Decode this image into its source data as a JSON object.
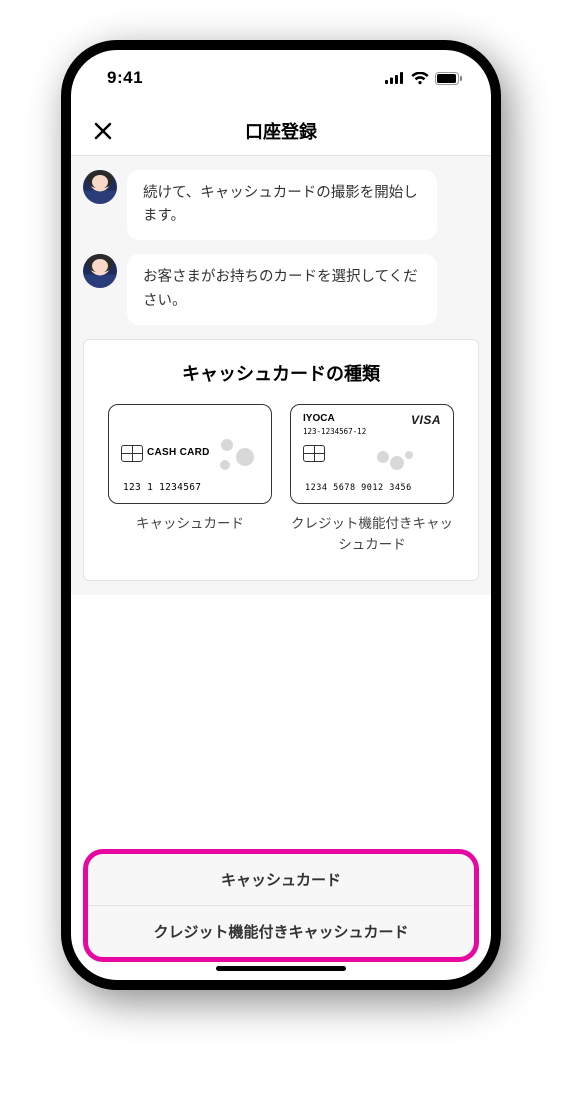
{
  "status": {
    "time": "9:41"
  },
  "header": {
    "title": "口座登録"
  },
  "messages": [
    {
      "text": "続けて、キャッシュカードの撮影を開始します。"
    },
    {
      "text": "お客さまがお持ちのカードを選択してください。"
    }
  ],
  "panel": {
    "title": "キャッシュカードの種類",
    "cards": [
      {
        "inner_label": "CASH CARD",
        "number": "123  1 1234567",
        "caption": "キャッシュカード"
      },
      {
        "brand": "VISA",
        "iyoca": "IYOCA",
        "sub": "123-1234567-12",
        "number": "1234 5678 9012 3456",
        "caption": "クレジット機能付きキャッシュカード"
      }
    ]
  },
  "options": {
    "opt1": "キャッシュカード",
    "opt2": "クレジット機能付きキャッシュカード"
  }
}
